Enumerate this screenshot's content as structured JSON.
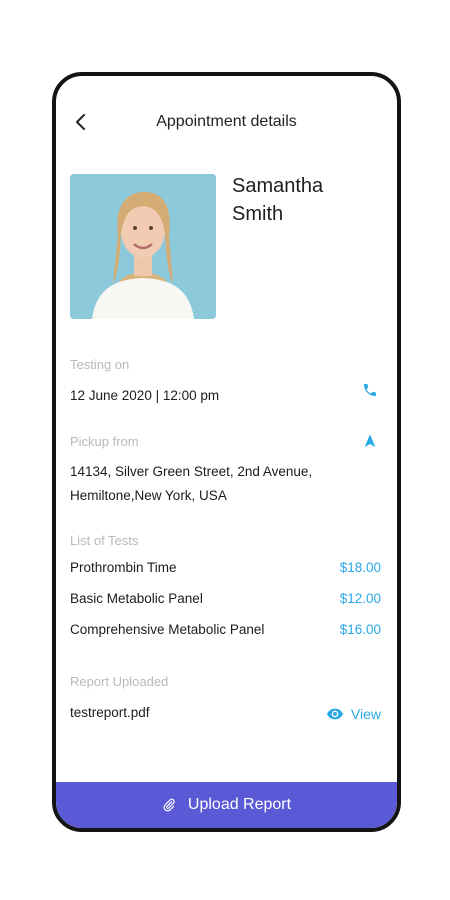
{
  "header": {
    "title": "Appointment details"
  },
  "patient": {
    "first_name": "Samantha",
    "last_name": "Smith"
  },
  "testing": {
    "label": "Testing on",
    "value": "12 June 2020 | 12:00 pm"
  },
  "pickup": {
    "label": "Pickup from",
    "line1": "14134, Silver Green Street, 2nd Avenue,",
    "line2": "Hemiltone,New York, USA"
  },
  "tests": {
    "label": "List of Tests",
    "items": [
      {
        "name": "Prothrombin Time",
        "price": "$18.00"
      },
      {
        "name": "Basic Metabolic Panel",
        "price": "$12.00"
      },
      {
        "name": "Comprehensive Metabolic Panel",
        "price": "$16.00"
      }
    ]
  },
  "report": {
    "label": "Report Uploaded",
    "file": "testreport.pdf",
    "view_label": "View"
  },
  "footer": {
    "upload_label": "Upload Report"
  },
  "icons": {
    "back": "chevron-left-icon",
    "phone": "phone-icon",
    "navigate": "navigation-arrow-icon",
    "view": "eye-icon",
    "attach": "paperclip-icon"
  },
  "colors": {
    "accent": "#29a8e6",
    "button": "#5a59d6",
    "muted_label": "#b9b9b9"
  }
}
